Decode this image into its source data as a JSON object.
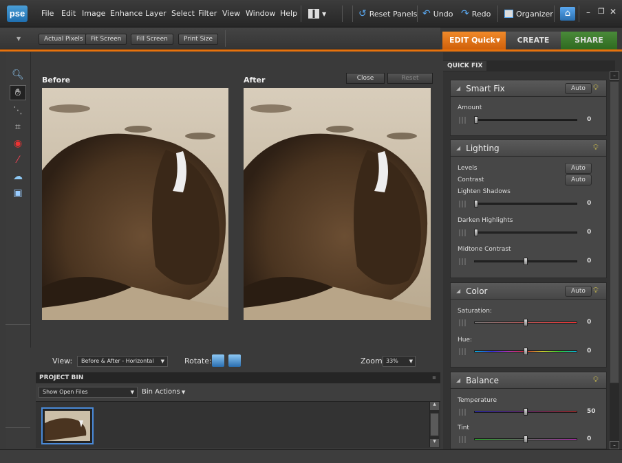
{
  "app": {
    "logo": "pse"
  },
  "menu": [
    "File",
    "Edit",
    "Image",
    "Enhance",
    "Layer",
    "Select",
    "Filter",
    "View",
    "Window",
    "Help"
  ],
  "toolbar": {
    "reset_panels": "Reset Panels",
    "undo": "Undo",
    "redo": "Redo",
    "organizer": "Organizer"
  },
  "options": {
    "actual_pixels": "Actual Pixels",
    "fit_screen": "Fit Screen",
    "fill_screen": "Fill Screen",
    "print_size": "Print Size"
  },
  "modes": {
    "edit": "EDIT Quick",
    "create": "CREATE",
    "share": "SHARE"
  },
  "work": {
    "before": "Before",
    "after": "After",
    "close": "Close",
    "reset": "Reset"
  },
  "viewbar": {
    "view_label": "View:",
    "view_value": "Before & After - Horizontal",
    "rotate_label": "Rotate:",
    "zoom_label": "Zoom:",
    "zoom_value": "33%"
  },
  "bin": {
    "title": "PROJECT BIN",
    "show_value": "Show Open Files",
    "actions": "Bin Actions"
  },
  "panel": {
    "tab": "QUICK FIX",
    "smartfix": {
      "title": "Smart Fix",
      "auto": "Auto",
      "amount_label": "Amount",
      "amount_value": "0",
      "amount_pos": 0
    },
    "lighting": {
      "title": "Lighting",
      "levels": "Levels",
      "levels_auto": "Auto",
      "contrast": "Contrast",
      "contrast_auto": "Auto",
      "shadows_label": "Lighten Shadows",
      "shadows_value": "0",
      "shadows_pos": 0,
      "highlights_label": "Darken Highlights",
      "highlights_value": "0",
      "highlights_pos": 0,
      "midtone_label": "Midtone Contrast",
      "midtone_value": "0",
      "midtone_pos": 0.5
    },
    "color": {
      "title": "Color",
      "auto": "Auto",
      "sat_label": "Saturation:",
      "sat_value": "0",
      "sat_pos": 0.5,
      "hue_label": "Hue:",
      "hue_value": "0",
      "hue_pos": 0.5
    },
    "balance": {
      "title": "Balance",
      "temp_label": "Temperature",
      "temp_value": "50",
      "temp_pos": 0.5,
      "tint_label": "Tint",
      "tint_value": "0",
      "tint_pos": 0.5
    }
  },
  "colors": {
    "accent": "#e8720c",
    "create": "#4a4a4a",
    "share": "#3a7a2a"
  }
}
